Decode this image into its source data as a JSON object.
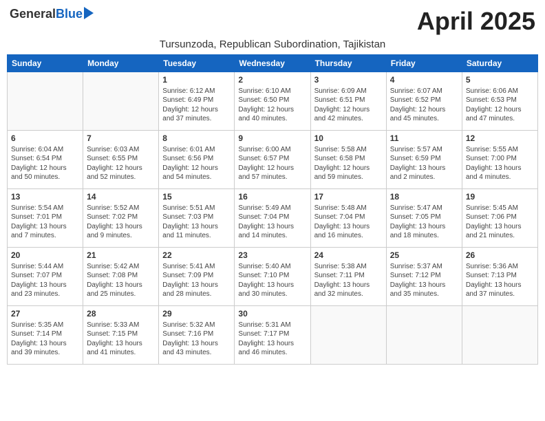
{
  "logo": {
    "general": "General",
    "blue": "Blue"
  },
  "title": "April 2025",
  "subtitle": "Tursunzoda, Republican Subordination, Tajikistan",
  "weekdays": [
    "Sunday",
    "Monday",
    "Tuesday",
    "Wednesday",
    "Thursday",
    "Friday",
    "Saturday"
  ],
  "weeks": [
    [
      {
        "day": "",
        "info": ""
      },
      {
        "day": "",
        "info": ""
      },
      {
        "day": "1",
        "sunrise": "6:12 AM",
        "sunset": "6:49 PM",
        "daylight": "12 hours and 37 minutes."
      },
      {
        "day": "2",
        "sunrise": "6:10 AM",
        "sunset": "6:50 PM",
        "daylight": "12 hours and 40 minutes."
      },
      {
        "day": "3",
        "sunrise": "6:09 AM",
        "sunset": "6:51 PM",
        "daylight": "12 hours and 42 minutes."
      },
      {
        "day": "4",
        "sunrise": "6:07 AM",
        "sunset": "6:52 PM",
        "daylight": "12 hours and 45 minutes."
      },
      {
        "day": "5",
        "sunrise": "6:06 AM",
        "sunset": "6:53 PM",
        "daylight": "12 hours and 47 minutes."
      }
    ],
    [
      {
        "day": "6",
        "sunrise": "6:04 AM",
        "sunset": "6:54 PM",
        "daylight": "12 hours and 50 minutes."
      },
      {
        "day": "7",
        "sunrise": "6:03 AM",
        "sunset": "6:55 PM",
        "daylight": "12 hours and 52 minutes."
      },
      {
        "day": "8",
        "sunrise": "6:01 AM",
        "sunset": "6:56 PM",
        "daylight": "12 hours and 54 minutes."
      },
      {
        "day": "9",
        "sunrise": "6:00 AM",
        "sunset": "6:57 PM",
        "daylight": "12 hours and 57 minutes."
      },
      {
        "day": "10",
        "sunrise": "5:58 AM",
        "sunset": "6:58 PM",
        "daylight": "12 hours and 59 minutes."
      },
      {
        "day": "11",
        "sunrise": "5:57 AM",
        "sunset": "6:59 PM",
        "daylight": "13 hours and 2 minutes."
      },
      {
        "day": "12",
        "sunrise": "5:55 AM",
        "sunset": "7:00 PM",
        "daylight": "13 hours and 4 minutes."
      }
    ],
    [
      {
        "day": "13",
        "sunrise": "5:54 AM",
        "sunset": "7:01 PM",
        "daylight": "13 hours and 7 minutes."
      },
      {
        "day": "14",
        "sunrise": "5:52 AM",
        "sunset": "7:02 PM",
        "daylight": "13 hours and 9 minutes."
      },
      {
        "day": "15",
        "sunrise": "5:51 AM",
        "sunset": "7:03 PM",
        "daylight": "13 hours and 11 minutes."
      },
      {
        "day": "16",
        "sunrise": "5:49 AM",
        "sunset": "7:04 PM",
        "daylight": "13 hours and 14 minutes."
      },
      {
        "day": "17",
        "sunrise": "5:48 AM",
        "sunset": "7:04 PM",
        "daylight": "13 hours and 16 minutes."
      },
      {
        "day": "18",
        "sunrise": "5:47 AM",
        "sunset": "7:05 PM",
        "daylight": "13 hours and 18 minutes."
      },
      {
        "day": "19",
        "sunrise": "5:45 AM",
        "sunset": "7:06 PM",
        "daylight": "13 hours and 21 minutes."
      }
    ],
    [
      {
        "day": "20",
        "sunrise": "5:44 AM",
        "sunset": "7:07 PM",
        "daylight": "13 hours and 23 minutes."
      },
      {
        "day": "21",
        "sunrise": "5:42 AM",
        "sunset": "7:08 PM",
        "daylight": "13 hours and 25 minutes."
      },
      {
        "day": "22",
        "sunrise": "5:41 AM",
        "sunset": "7:09 PM",
        "daylight": "13 hours and 28 minutes."
      },
      {
        "day": "23",
        "sunrise": "5:40 AM",
        "sunset": "7:10 PM",
        "daylight": "13 hours and 30 minutes."
      },
      {
        "day": "24",
        "sunrise": "5:38 AM",
        "sunset": "7:11 PM",
        "daylight": "13 hours and 32 minutes."
      },
      {
        "day": "25",
        "sunrise": "5:37 AM",
        "sunset": "7:12 PM",
        "daylight": "13 hours and 35 minutes."
      },
      {
        "day": "26",
        "sunrise": "5:36 AM",
        "sunset": "7:13 PM",
        "daylight": "13 hours and 37 minutes."
      }
    ],
    [
      {
        "day": "27",
        "sunrise": "5:35 AM",
        "sunset": "7:14 PM",
        "daylight": "13 hours and 39 minutes."
      },
      {
        "day": "28",
        "sunrise": "5:33 AM",
        "sunset": "7:15 PM",
        "daylight": "13 hours and 41 minutes."
      },
      {
        "day": "29",
        "sunrise": "5:32 AM",
        "sunset": "7:16 PM",
        "daylight": "13 hours and 43 minutes."
      },
      {
        "day": "30",
        "sunrise": "5:31 AM",
        "sunset": "7:17 PM",
        "daylight": "13 hours and 46 minutes."
      },
      {
        "day": "",
        "info": ""
      },
      {
        "day": "",
        "info": ""
      },
      {
        "day": "",
        "info": ""
      }
    ]
  ],
  "labels": {
    "sunrise_prefix": "Sunrise: ",
    "sunset_prefix": "Sunset: ",
    "daylight_prefix": "Daylight: "
  }
}
